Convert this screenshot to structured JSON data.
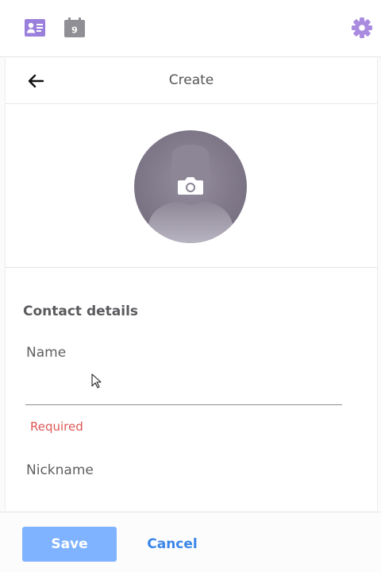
{
  "topbar": {
    "contacts_icon": "contact-card-icon",
    "calendar_icon": "calendar-icon",
    "calendar_day": "9",
    "settings_icon": "gear-icon",
    "accent_color": "#a98bdf"
  },
  "header": {
    "back_icon": "arrow-left-icon",
    "title": "Create"
  },
  "photo": {
    "avatar": "avatar-placeholder",
    "camera_icon": "camera-icon"
  },
  "details": {
    "heading": "Contact details",
    "name_label": "Name",
    "name_value": "",
    "name_error": "Required",
    "nickname_label": "Nickname"
  },
  "footer": {
    "save_label": "Save",
    "cancel_label": "Cancel",
    "save_color": "#7fb3ff",
    "cancel_color": "#3a86e8"
  }
}
